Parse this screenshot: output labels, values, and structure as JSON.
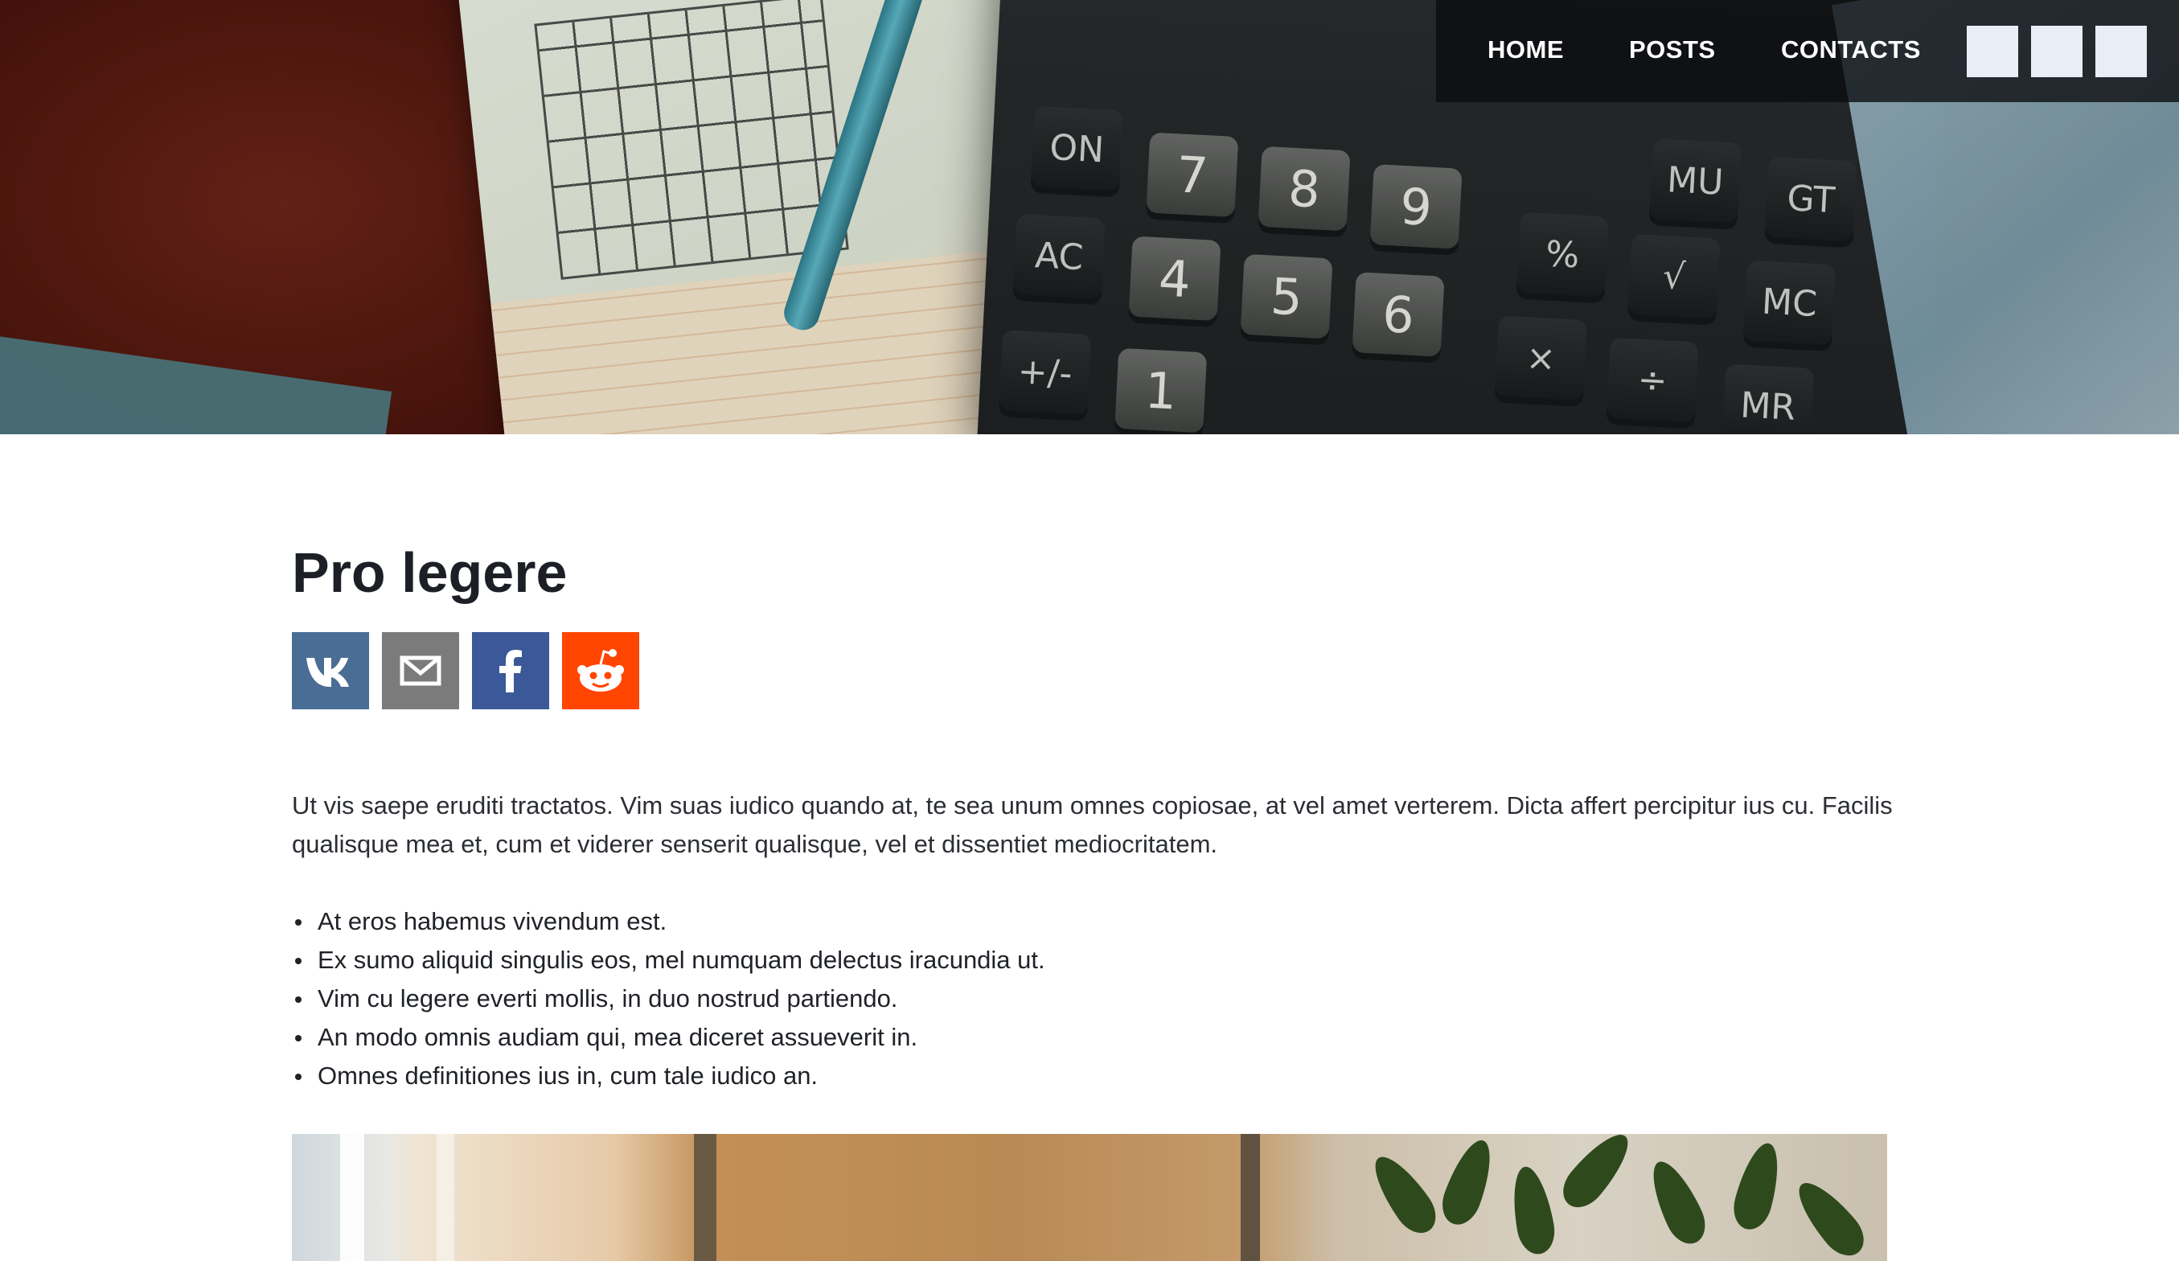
{
  "nav": {
    "links": [
      "HOME",
      "POSTS",
      "CONTACTS"
    ],
    "squares": [
      "nav-square-1",
      "nav-square-2",
      "nav-square-3"
    ]
  },
  "hero": {
    "calculator_keys": [
      "ON",
      "7",
      "8",
      "9",
      "MU",
      "GT",
      "AC",
      "4",
      "5",
      "6",
      "%",
      "√",
      "MC",
      "+/-",
      "1",
      "×",
      "÷",
      "MR"
    ]
  },
  "post": {
    "title": "Pro legere",
    "share_icons": [
      "vk-icon",
      "mail-icon",
      "facebook-icon",
      "reddit-icon"
    ],
    "paragraph": "Ut vis saepe eruditi tractatos. Vim suas iudico quando at, te sea unum omnes copiosae, at vel amet verterem. Dicta affert percipitur ius cu. Facilis qualisque mea et, cum et viderer senserit qualisque, vel et dissentiet mediocritatem.",
    "bullets": [
      "At eros habemus vivendum est.",
      "Ex sumo aliquid singulis eos, mel numquam delectus iracundia ut.",
      "Vim cu legere everti mollis, in duo nostrud partiendo.",
      "An modo omnis audiam qui, mea diceret assueverit in.",
      "Omnes definitiones ius in, cum tale iudico an."
    ]
  },
  "colors": {
    "vk": "#4a6d95",
    "mail": "#7b7b7b",
    "facebook": "#3b5998",
    "reddit": "#ff4500",
    "nav_bg": "#0a0c0e",
    "nav_square": "#e8eef5"
  }
}
